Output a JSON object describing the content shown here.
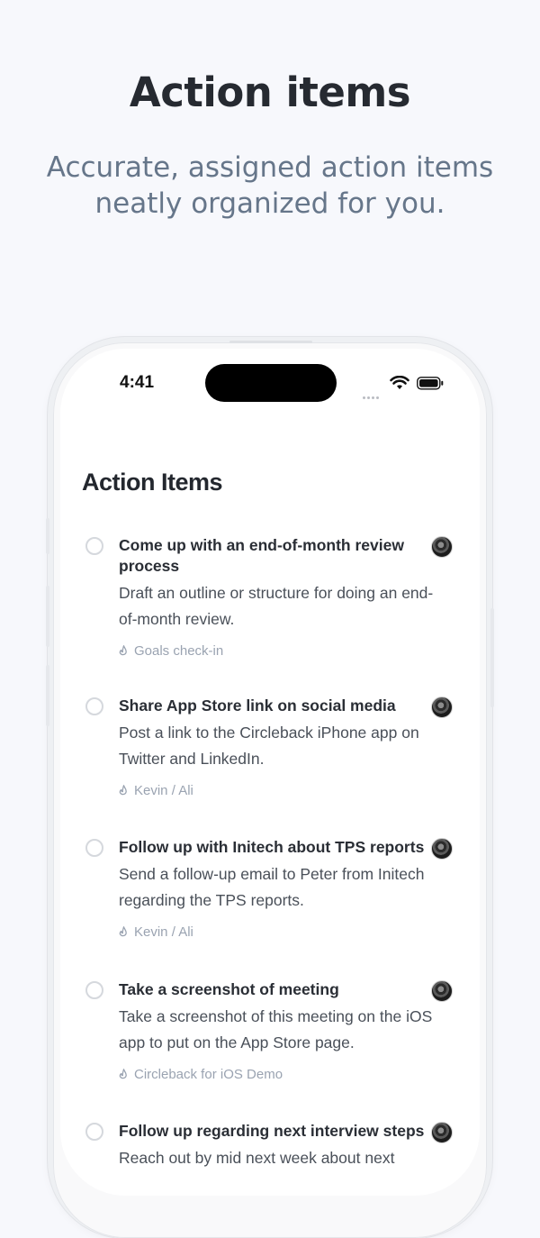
{
  "hero": {
    "title": "Action items",
    "subtitle": "Accurate, assigned action items neatly organized for you."
  },
  "status_bar": {
    "time": "4:41"
  },
  "screen": {
    "title": "Action Items"
  },
  "items": [
    {
      "title": "Come up with an end-of-month review process",
      "description": "Draft an outline or structure for doing an end-of-month review.",
      "meeting": "Goals check-in"
    },
    {
      "title": "Share App Store link on social media",
      "description": "Post a link to the Circleback iPhone app on Twitter and LinkedIn.",
      "meeting": "Kevin / Ali"
    },
    {
      "title": "Follow up with Initech about TPS reports",
      "description": "Send a follow-up email to Peter from Initech regarding the TPS reports.",
      "meeting": "Kevin / Ali"
    },
    {
      "title": "Take a screenshot of meeting",
      "description": "Take a screenshot of this meeting on the iOS app to put on the App Store page.",
      "meeting": "Circleback for iOS Demo"
    },
    {
      "title": "Follow up regarding next interview steps",
      "description": "Reach out by mid next week about next",
      "meeting": ""
    }
  ],
  "colors": {
    "background": "#f7f8fc",
    "headline": "#262a31",
    "subhead": "#66768a",
    "meeting_label": "#9aa3b1"
  },
  "icons": {
    "meeting": "fire-icon",
    "checkbox": "circle-checkbox-icon",
    "assignee": "avatar"
  }
}
